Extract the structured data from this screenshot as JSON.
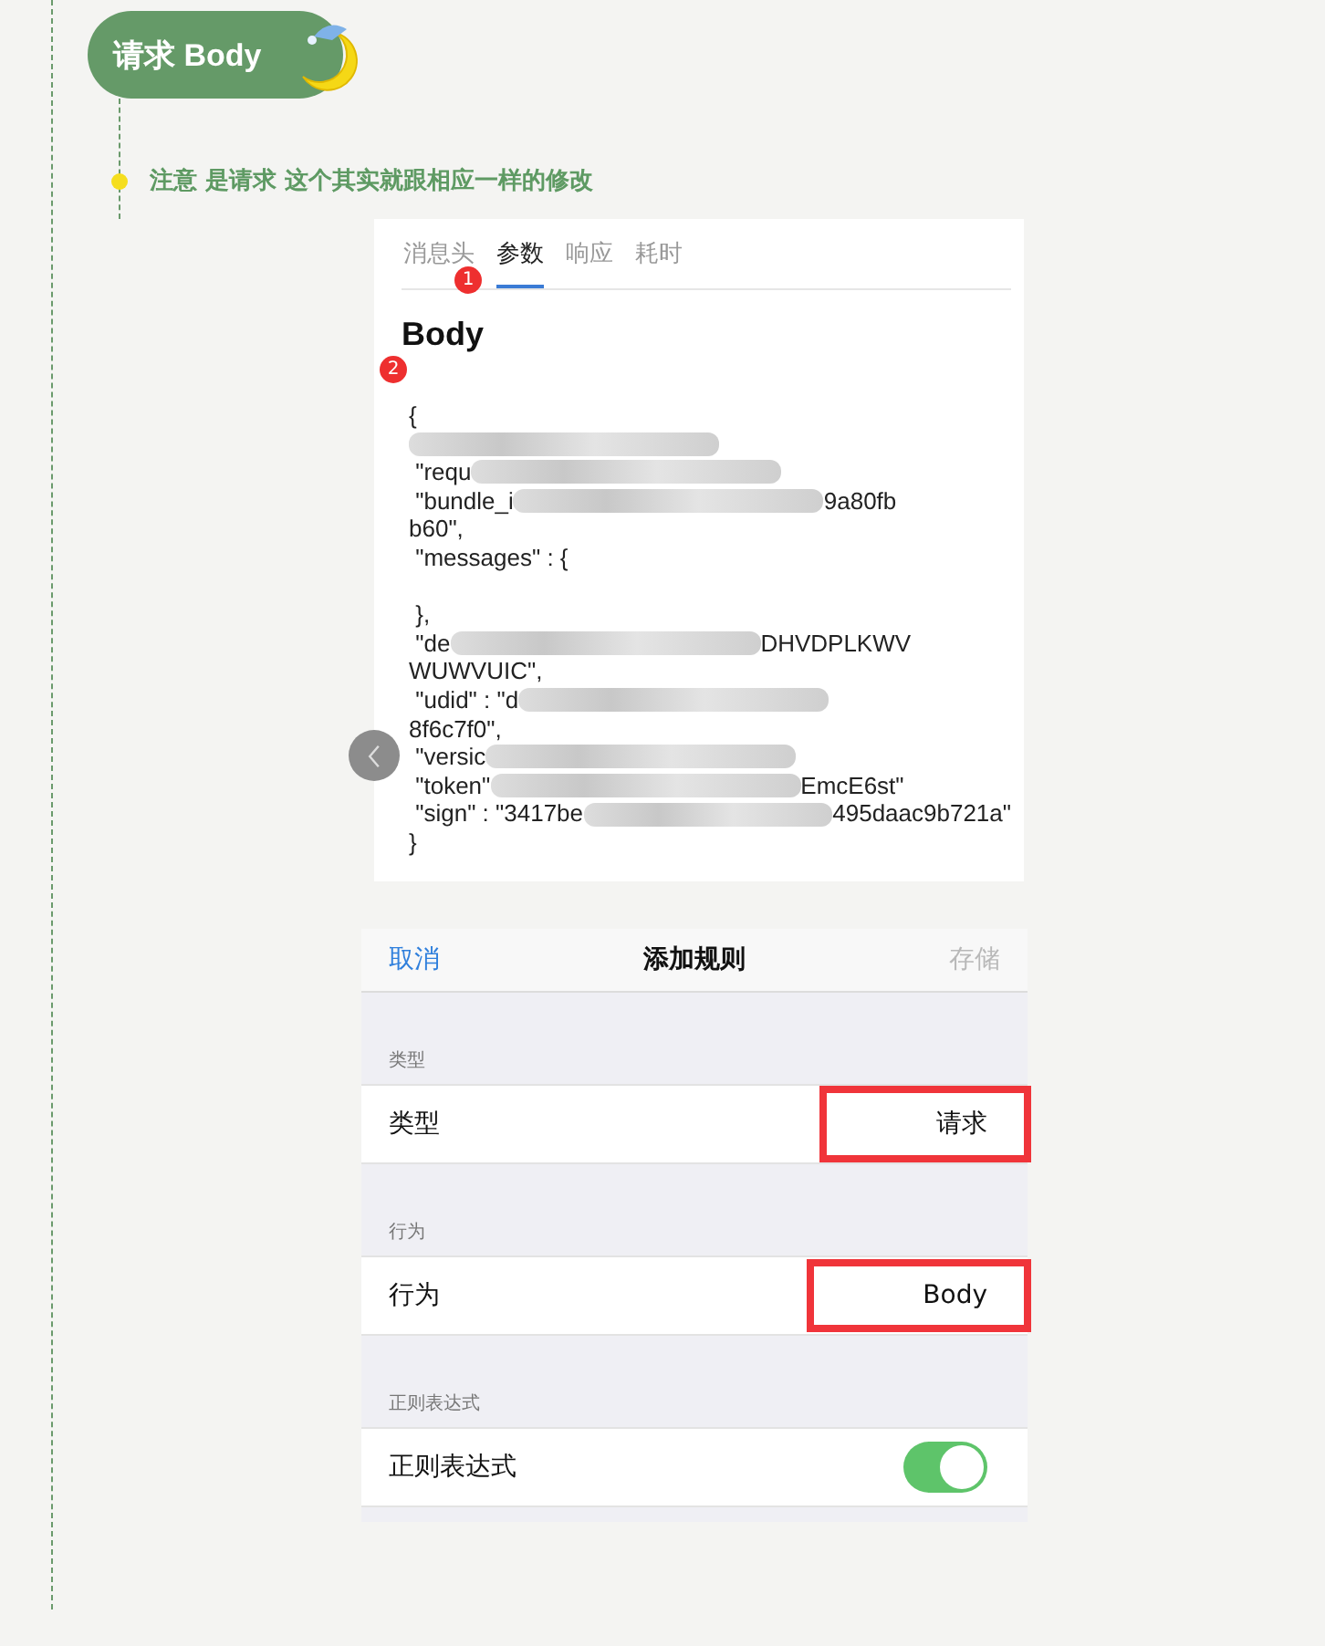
{
  "heading": {
    "title": "请求 Body"
  },
  "note": {
    "text": "注意 是请求  这个其实就跟相应一样的修改"
  },
  "detail_screen": {
    "tabs": [
      {
        "label": "消息头",
        "selected": false
      },
      {
        "label": "参数",
        "selected": true
      },
      {
        "label": "响应",
        "selected": false
      },
      {
        "label": "耗时",
        "selected": false
      }
    ],
    "markers": [
      "1",
      "2"
    ],
    "title": "Body",
    "code_lines": [
      {
        "before": "{"
      },
      {
        "redacted": true
      },
      {
        "before": " \"requ",
        "redacted": true
      },
      {
        "before": " \"bundle_i",
        "redacted": true,
        "after": "9a80fb"
      },
      {
        "before": "b60\","
      },
      {
        "before": " \"messages\" : {"
      },
      {
        "before": " },",
        "gap_before": true
      },
      {
        "before": " \"de",
        "redacted": true,
        "after": "DHVDPLKWV"
      },
      {
        "before": "WUWVUIC\","
      },
      {
        "before": " \"udid\" : \"d",
        "redacted": true
      },
      {
        "before": "8f6c7f0\","
      },
      {
        "before": " \"versic",
        "redacted": true
      },
      {
        "before": " \"token\"",
        "redacted": true,
        "after": "EmcE6st\""
      },
      {
        "before": " \"sign\" : \"3417be",
        "redacted": true,
        "after": "495daac9b721a\""
      },
      {
        "before": "}"
      }
    ]
  },
  "rule_screen": {
    "cancel": "取消",
    "title": "添加规则",
    "save": {
      "label": "存储",
      "disabled": true
    },
    "sections": [
      {
        "header": "类型",
        "label": "类型",
        "kind": "value",
        "value": "请求",
        "highlighted": true
      },
      {
        "header": "行为",
        "label": "行为",
        "kind": "value",
        "value": "Body",
        "highlighted": true
      },
      {
        "header": "正则表达式",
        "label": "正则表达式",
        "kind": "toggle",
        "on": true
      }
    ]
  }
}
